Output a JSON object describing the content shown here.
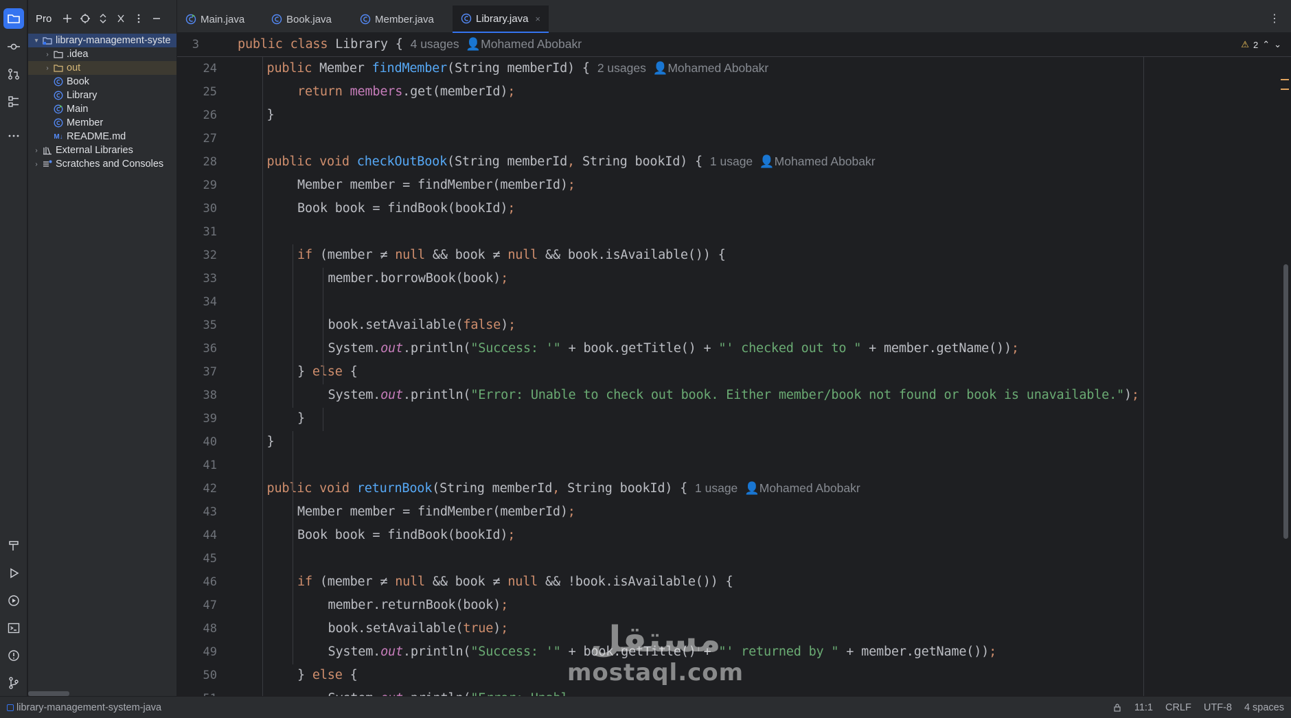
{
  "project_panel": {
    "title": "Pro",
    "tree": [
      {
        "label": "library-management-syste",
        "kind": "project-root",
        "arrow": "▾"
      },
      {
        "label": ".idea",
        "kind": "folder",
        "arrow": "›"
      },
      {
        "label": "out",
        "kind": "folder-excluded",
        "arrow": "›"
      },
      {
        "label": "Book",
        "kind": "class"
      },
      {
        "label": "Library",
        "kind": "class"
      },
      {
        "label": "Main",
        "kind": "class-main"
      },
      {
        "label": "Member",
        "kind": "class"
      },
      {
        "label": "README.md",
        "kind": "markdown",
        "badge": "M↓"
      },
      {
        "label": "External Libraries",
        "kind": "libraries",
        "arrow": "›"
      },
      {
        "label": "Scratches and Consoles",
        "kind": "scratches",
        "arrow": "›"
      }
    ]
  },
  "tabs": [
    {
      "label": "Main.java",
      "active": false
    },
    {
      "label": "Book.java",
      "active": false
    },
    {
      "label": "Member.java",
      "active": false
    },
    {
      "label": "Library.java",
      "active": true,
      "close": "×"
    }
  ],
  "editor": {
    "sticky": {
      "line": "3",
      "code": [
        [
          "kw",
          "public class "
        ],
        [
          "",
          "Library { "
        ],
        [
          "hint",
          "4 usages  "
        ],
        [
          "hint",
          "👤Mohamed Abobakr"
        ]
      ]
    },
    "inspection": {
      "icon": "⚠",
      "count": "2",
      "up": "⌃",
      "down": "⌄"
    },
    "lines": [
      {
        "n": "24",
        "indent": 1,
        "code": [
          [
            "kw",
            "public "
          ],
          [
            "",
            "Member "
          ],
          [
            "fn",
            "findMember"
          ],
          [
            "",
            "(String memberId) { "
          ],
          [
            "hint",
            "2 usages  "
          ],
          [
            "hint",
            "👤Mohamed Abobakr"
          ]
        ]
      },
      {
        "n": "25",
        "indent": 2,
        "code": [
          [
            "kw",
            "return "
          ],
          [
            "fld",
            "members"
          ],
          [
            "",
            ".get(memberId)"
          ],
          [
            "kw",
            ";"
          ]
        ]
      },
      {
        "n": "26",
        "indent": 1,
        "code": [
          [
            "",
            "}"
          ]
        ]
      },
      {
        "n": "27",
        "indent": 0,
        "code": []
      },
      {
        "n": "28",
        "indent": 1,
        "code": [
          [
            "kw",
            "public void "
          ],
          [
            "fn",
            "checkOutBook"
          ],
          [
            "",
            "(String memberId"
          ],
          [
            "kw",
            ", "
          ],
          [
            "",
            "String bookId) { "
          ],
          [
            "hint",
            "1 usage  "
          ],
          [
            "hint",
            "👤Mohamed Abobakr"
          ]
        ]
      },
      {
        "n": "29",
        "indent": 2,
        "code": [
          [
            "",
            "Member member = findMember(memberId)"
          ],
          [
            "kw",
            ";"
          ]
        ]
      },
      {
        "n": "30",
        "indent": 2,
        "code": [
          [
            "",
            "Book book = findBook(bookId)"
          ],
          [
            "kw",
            ";"
          ]
        ]
      },
      {
        "n": "31",
        "indent": 0,
        "code": []
      },
      {
        "n": "32",
        "indent": 2,
        "code": [
          [
            "kw",
            "if "
          ],
          [
            "",
            "(member ≠ "
          ],
          [
            "kw",
            "null "
          ],
          [
            "",
            "&& book ≠ "
          ],
          [
            "kw",
            "null "
          ],
          [
            "",
            "&& book.isAvailable()) {"
          ]
        ]
      },
      {
        "n": "33",
        "indent": 3,
        "code": [
          [
            "",
            "member.borrowBook(book)"
          ],
          [
            "kw",
            ";"
          ]
        ]
      },
      {
        "n": "34",
        "indent": 0,
        "code": []
      },
      {
        "n": "35",
        "indent": 3,
        "code": [
          [
            "",
            "book.setAvailable("
          ],
          [
            "kw",
            "false"
          ],
          [
            "",
            ")"
          ],
          [
            "kw",
            ";"
          ]
        ]
      },
      {
        "n": "36",
        "indent": 3,
        "code": [
          [
            "",
            "System."
          ],
          [
            "it",
            "out"
          ],
          [
            "",
            ".println("
          ],
          [
            "st",
            "\"Success: '\""
          ],
          [
            "",
            " + book.getTitle() + "
          ],
          [
            "st",
            "\"' checked out to \""
          ],
          [
            "",
            " + member.getName())"
          ],
          [
            "kw",
            ";"
          ]
        ]
      },
      {
        "n": "37",
        "indent": 2,
        "code": [
          [
            "",
            "} "
          ],
          [
            "kw",
            "else "
          ],
          [
            "",
            "{"
          ]
        ]
      },
      {
        "n": "38",
        "indent": 3,
        "code": [
          [
            "",
            "System."
          ],
          [
            "it",
            "out"
          ],
          [
            "",
            ".println("
          ],
          [
            "st",
            "\"Error: Unable to check out book. Either member/book not found or book is unavailable.\""
          ],
          [
            "",
            ")"
          ],
          [
            "kw",
            ";"
          ]
        ]
      },
      {
        "n": "39",
        "indent": 2,
        "code": [
          [
            "",
            "}"
          ]
        ]
      },
      {
        "n": "40",
        "indent": 1,
        "code": [
          [
            "",
            "}"
          ]
        ]
      },
      {
        "n": "41",
        "indent": 0,
        "code": []
      },
      {
        "n": "42",
        "indent": 1,
        "code": [
          [
            "kw",
            "public void "
          ],
          [
            "fn",
            "returnBook"
          ],
          [
            "",
            "(String memberId"
          ],
          [
            "kw",
            ", "
          ],
          [
            "",
            "String bookId) { "
          ],
          [
            "hint",
            "1 usage  "
          ],
          [
            "hint",
            "👤Mohamed Abobakr"
          ]
        ]
      },
      {
        "n": "43",
        "indent": 2,
        "code": [
          [
            "",
            "Member member = findMember(memberId)"
          ],
          [
            "kw",
            ";"
          ]
        ]
      },
      {
        "n": "44",
        "indent": 2,
        "code": [
          [
            "",
            "Book book = findBook(bookId)"
          ],
          [
            "kw",
            ";"
          ]
        ]
      },
      {
        "n": "45",
        "indent": 0,
        "code": []
      },
      {
        "n": "46",
        "indent": 2,
        "code": [
          [
            "kw",
            "if "
          ],
          [
            "",
            "(member ≠ "
          ],
          [
            "kw",
            "null "
          ],
          [
            "",
            "&& book ≠ "
          ],
          [
            "kw",
            "null "
          ],
          [
            "",
            "&& !book.isAvailable()) {"
          ]
        ]
      },
      {
        "n": "47",
        "indent": 3,
        "code": [
          [
            "",
            "member.returnBook(book)"
          ],
          [
            "kw",
            ";"
          ]
        ]
      },
      {
        "n": "48",
        "indent": 3,
        "code": [
          [
            "",
            "book.setAvailable("
          ],
          [
            "kw",
            "true"
          ],
          [
            "",
            ")"
          ],
          [
            "kw",
            ";"
          ]
        ]
      },
      {
        "n": "49",
        "indent": 3,
        "code": [
          [
            "",
            "System."
          ],
          [
            "it",
            "out"
          ],
          [
            "",
            ".println("
          ],
          [
            "st",
            "\"Success: '\""
          ],
          [
            "",
            " + book.getTitle() + "
          ],
          [
            "st",
            "\"' returned by \""
          ],
          [
            "",
            " + member.getName())"
          ],
          [
            "kw",
            ";"
          ]
        ]
      },
      {
        "n": "50",
        "indent": 2,
        "code": [
          [
            "",
            "} "
          ],
          [
            "kw",
            "else "
          ],
          [
            "",
            "{"
          ]
        ]
      },
      {
        "n": "51",
        "indent": 3,
        "code": [
          [
            "",
            "System."
          ],
          [
            "it",
            "out"
          ],
          [
            "",
            ".println("
          ],
          [
            "st",
            "\"Error: Unabl"
          ]
        ]
      }
    ]
  },
  "watermark": {
    "arabic": "مستقل",
    "latin": "mostaql.com"
  },
  "statusbar": {
    "project": "library-management-system-java",
    "position": "11:1",
    "line_ending": "CRLF",
    "encoding": "UTF-8",
    "indent": "4 spaces"
  },
  "colors": {
    "accent": "#3574f0",
    "keyword": "#cf8e6d",
    "function": "#56a8f5",
    "string": "#6aab73",
    "field": "#c77dbb",
    "background": "#1e1f22",
    "panel": "#2b2d30"
  }
}
